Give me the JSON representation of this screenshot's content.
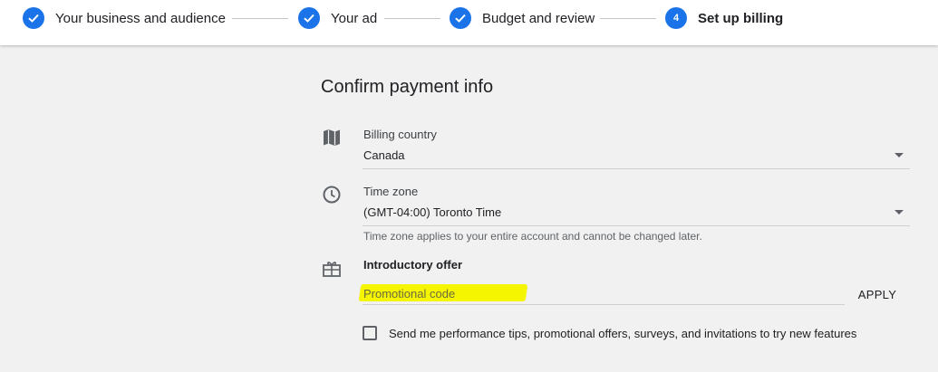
{
  "stepper": {
    "steps": [
      {
        "number": "1",
        "label": "Your business and audience",
        "state": "complete"
      },
      {
        "number": "2",
        "label": "Your ad",
        "state": "complete"
      },
      {
        "number": "3",
        "label": "Budget and review",
        "state": "complete"
      },
      {
        "number": "4",
        "label": "Set up billing",
        "state": "active"
      }
    ]
  },
  "main": {
    "title": "Confirm payment info",
    "billing_country": {
      "icon": "map-icon",
      "label": "Billing country",
      "value": "Canada"
    },
    "time_zone": {
      "icon": "clock-icon",
      "label": "Time zone",
      "value": "(GMT-04:00) Toronto Time",
      "helper": "Time zone applies to your entire account and cannot be changed later."
    },
    "introductory_offer": {
      "icon": "gift-icon",
      "label": "Introductory offer",
      "promo_placeholder": "Promotional code",
      "promo_value": "",
      "apply_label": "APPLY"
    },
    "marketing_opt_in": {
      "checked": false,
      "label": "Send me performance tips, promotional offers, surveys, and invitations to try new features"
    }
  },
  "colors": {
    "accent": "#1a73e8",
    "highlight": "#f5f500",
    "background": "#f1f1f1"
  }
}
